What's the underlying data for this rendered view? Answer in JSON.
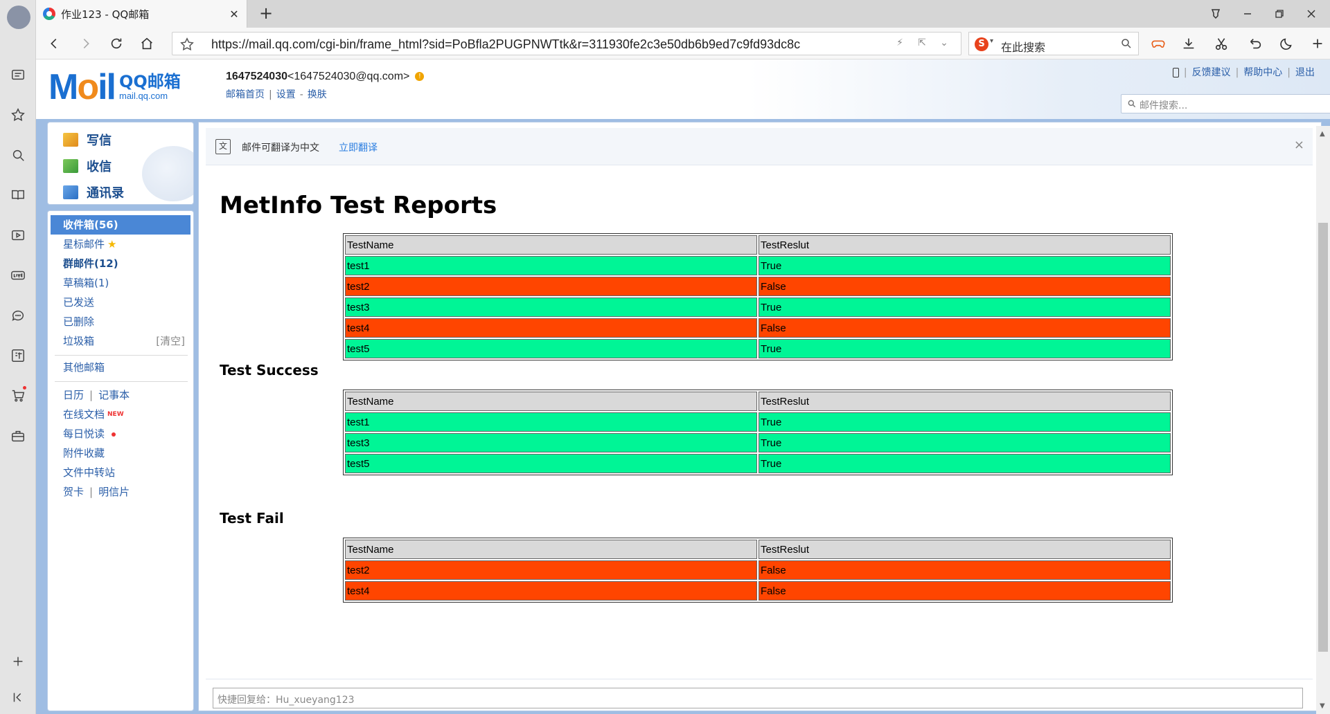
{
  "browser": {
    "tab_title": "作业123 - QQ邮箱",
    "url": "https://mail.qq.com/cgi-bin/frame_html?sid=PoBfla2PUGPNWTtk&r=311930fe2c3e50db6b9ed7c9fd93dc8c",
    "search_placeholder": "在此搜索",
    "close_glyph": "✕",
    "newtab_glyph": "+"
  },
  "header": {
    "logo_moil_m": "M",
    "logo_moil_o": "o",
    "logo_moil_il": "il",
    "logo_qq": "QQ邮箱",
    "logo_domain": "mail.qq.com",
    "user_id": "1647524030",
    "user_email": "<1647524030@qq.com>",
    "links": [
      "邮箱首页",
      "设置",
      "换肤"
    ],
    "top_links": [
      "反馈建议",
      "帮助中心",
      "退出"
    ],
    "search_placeholder": "邮件搜索..."
  },
  "actions": {
    "compose": "写信",
    "inbox": "收信",
    "contacts": "通讯录"
  },
  "folders": {
    "inbox": "收件箱(56)",
    "starred": "星标邮件",
    "group": "群邮件(12)",
    "drafts": "草稿箱(1)",
    "sent": "已发送",
    "deleted": "已删除",
    "trash": "垃圾箱",
    "trash_clear": "[清空]",
    "other": "其他邮箱",
    "calendar": "日历",
    "notes": "记事本",
    "docs": "在线文档",
    "docs_badge": "NEW",
    "daily": "每日悦读",
    "attach": "附件收藏",
    "transfer": "文件中转站",
    "cards": "贺卡",
    "postcards": "明信片",
    "sep": "|"
  },
  "translate": {
    "icon_text": "文",
    "text": "邮件可翻译为中文",
    "link": "立即翻译",
    "close": "×"
  },
  "mail": {
    "title": "MetInfo Test Reports",
    "col_name": "TestName",
    "col_result": "TestReslut",
    "all": [
      {
        "name": "test1",
        "result": "True"
      },
      {
        "name": "test2",
        "result": "False"
      },
      {
        "name": "test3",
        "result": "True"
      },
      {
        "name": "test4",
        "result": "False"
      },
      {
        "name": "test5",
        "result": "True"
      }
    ],
    "success_title": "Test Success",
    "success": [
      {
        "name": "test1",
        "result": "True"
      },
      {
        "name": "test3",
        "result": "True"
      },
      {
        "name": "test5",
        "result": "True"
      }
    ],
    "fail_title": "Test Fail",
    "fail": [
      {
        "name": "test2",
        "result": "False"
      },
      {
        "name": "test4",
        "result": "False"
      }
    ]
  },
  "quick_reply_placeholder": "快捷回复给：Hu_xueyang123",
  "colors": {
    "pass": "#00f596",
    "fail": "#ff4500",
    "header_row": "#d9d9d9",
    "accent": "#4a87d6"
  }
}
